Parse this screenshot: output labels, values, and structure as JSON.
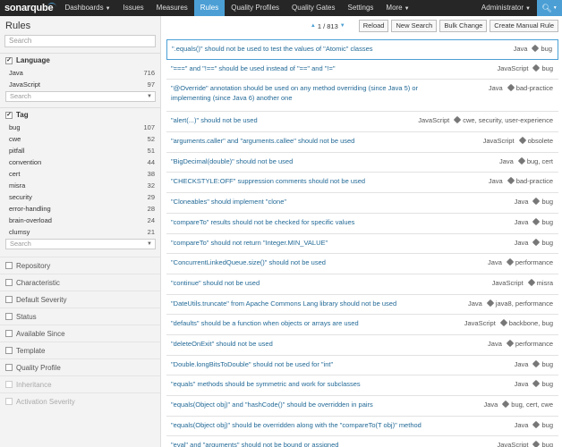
{
  "nav": {
    "logo": "sonarqube",
    "items": [
      {
        "label": "Dashboards",
        "caret": true,
        "active": false
      },
      {
        "label": "Issues",
        "caret": false,
        "active": false
      },
      {
        "label": "Measures",
        "caret": false,
        "active": false
      },
      {
        "label": "Rules",
        "caret": false,
        "active": true
      },
      {
        "label": "Quality Profiles",
        "caret": false,
        "active": false
      },
      {
        "label": "Quality Gates",
        "caret": false,
        "active": false
      },
      {
        "label": "Settings",
        "caret": false,
        "active": false
      },
      {
        "label": "More",
        "caret": true,
        "active": false
      }
    ],
    "user": "Administrator",
    "search_icon": "magnifier-icon",
    "accent": "#4b9fd5"
  },
  "sidebar": {
    "title": "Rules",
    "search_placeholder": "Search",
    "language": {
      "label": "Language",
      "items": [
        {
          "name": "Java",
          "count": "716"
        },
        {
          "name": "JavaScript",
          "count": "97"
        }
      ],
      "search_placeholder": "Search"
    },
    "tag": {
      "label": "Tag",
      "items": [
        {
          "name": "bug",
          "count": "107"
        },
        {
          "name": "cwe",
          "count": "52"
        },
        {
          "name": "pitfall",
          "count": "51"
        },
        {
          "name": "convention",
          "count": "44"
        },
        {
          "name": "cert",
          "count": "38"
        },
        {
          "name": "misra",
          "count": "32"
        },
        {
          "name": "security",
          "count": "29"
        },
        {
          "name": "error-handling",
          "count": "28"
        },
        {
          "name": "brain-overload",
          "count": "24"
        },
        {
          "name": "clumsy",
          "count": "21"
        }
      ],
      "search_placeholder": "Search"
    },
    "collapsed": [
      {
        "label": "Repository",
        "disabled": false
      },
      {
        "label": "Characteristic",
        "disabled": false
      },
      {
        "label": "Default Severity",
        "disabled": false
      },
      {
        "label": "Status",
        "disabled": false
      },
      {
        "label": "Available Since",
        "disabled": false
      },
      {
        "label": "Template",
        "disabled": false
      },
      {
        "label": "Quality Profile",
        "disabled": false
      },
      {
        "label": "Inheritance",
        "disabled": true
      },
      {
        "label": "Activation Severity",
        "disabled": true
      }
    ]
  },
  "toolbar": {
    "pager": "1 / 813",
    "buttons": [
      "Reload",
      "New Search",
      "Bulk Change",
      "Create Manual Rule"
    ]
  },
  "rules": [
    {
      "title": "\".equals()\" should not be used to test the values of \"Atomic\" classes",
      "lang": "Java",
      "tags": "bug",
      "selected": true
    },
    {
      "title": "\"===\" and \"!==\" should be used instead of \"==\" and \"!=\"",
      "lang": "JavaScript",
      "tags": "bug"
    },
    {
      "title": "\"@Override\" annotation should be used on any method overriding (since Java 5) or implementing (since Java 6) another one",
      "lang": "Java",
      "tags": "bad-practice"
    },
    {
      "title": "\"alert(...)\" should not be used",
      "lang": "JavaScript",
      "tags": "cwe, security, user-experience"
    },
    {
      "title": "\"arguments.caller\" and \"arguments.callee\" should not be used",
      "lang": "JavaScript",
      "tags": "obsolete"
    },
    {
      "title": "\"BigDecimal(double)\" should not be used",
      "lang": "Java",
      "tags": "bug, cert"
    },
    {
      "title": "\"CHECKSTYLE:OFF\" suppression comments should not be used",
      "lang": "Java",
      "tags": "bad-practice"
    },
    {
      "title": "\"Cloneables\" should implement \"clone\"",
      "lang": "Java",
      "tags": "bug"
    },
    {
      "title": "\"compareTo\" results should not be checked for specific values",
      "lang": "Java",
      "tags": "bug"
    },
    {
      "title": "\"compareTo\" should not return \"Integer.MIN_VALUE\"",
      "lang": "Java",
      "tags": "bug"
    },
    {
      "title": "\"ConcurrentLinkedQueue.size()\" should not be used",
      "lang": "Java",
      "tags": "performance"
    },
    {
      "title": "\"continue\" should not be used",
      "lang": "JavaScript",
      "tags": "misra"
    },
    {
      "title": "\"DateUtils.truncate\" from Apache Commons Lang library should not be used",
      "lang": "Java",
      "tags": "java8, performance"
    },
    {
      "title": "\"defaults\" should be a function when objects or arrays are used",
      "lang": "JavaScript",
      "tags": "backbone, bug"
    },
    {
      "title": "\"deleteOnExit\" should not be used",
      "lang": "Java",
      "tags": "performance"
    },
    {
      "title": "\"Double.longBitsToDouble\" should not be used for \"int\"",
      "lang": "Java",
      "tags": "bug"
    },
    {
      "title": "\"equals\" methods should be symmetric and work for subclasses",
      "lang": "Java",
      "tags": "bug"
    },
    {
      "title": "\"equals(Object obj)\" and \"hashCode()\" should be overridden in pairs",
      "lang": "Java",
      "tags": "bug, cert, cwe"
    },
    {
      "title": "\"equals(Object obj)\" should be overridden along with the \"compareTo(T obj)\" method",
      "lang": "Java",
      "tags": "bug"
    },
    {
      "title": "\"eval\" and \"arguments\" should not be bound or assigned",
      "lang": "JavaScript",
      "tags": "bug"
    }
  ]
}
